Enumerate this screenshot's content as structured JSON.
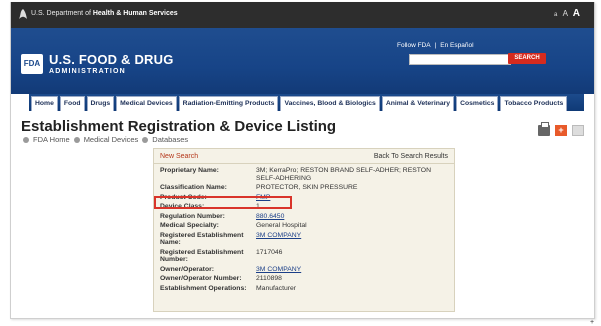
{
  "hhs": {
    "prefix": "U.S. Department of ",
    "bold": "Health & Human Services"
  },
  "font_size_controls": [
    "a",
    "A",
    "A"
  ],
  "masthead": {
    "logo": "FDA",
    "title": "U.S. FOOD & DRUG",
    "subtitle": "ADMINISTRATION",
    "follow_link": "Follow FDA",
    "sep": "|",
    "espanol_link": "En Español",
    "search_value": "",
    "search_button": "SEARCH"
  },
  "nav_tabs": [
    "Home",
    "Food",
    "Drugs",
    "Medical Devices",
    "Radiation-Emitting Products",
    "Vaccines, Blood & Biologics",
    "Animal & Veterinary",
    "Cosmetics",
    "Tobacco Products"
  ],
  "page_title": "Establishment Registration & Device Listing",
  "breadcrumb": [
    "FDA Home",
    "Medical Devices",
    "Databases"
  ],
  "panel": {
    "new_search": "New Search",
    "back_link": "Back To Search Results",
    "rows": [
      {
        "label": "Proprietary Name:",
        "value": "3M; KerraPro; RESTON BRAND SELF-ADHER; RESTON SELF-ADHERING",
        "link": false
      },
      {
        "label": "Classification Name:",
        "value": "PROTECTOR, SKIN PRESSURE",
        "link": false
      },
      {
        "label": "Product Code:",
        "value": "FMP",
        "link": true
      },
      {
        "label": "Device Class:",
        "value": "1",
        "link": false
      },
      {
        "label": "Regulation Number:",
        "value": "880.6450",
        "link": true
      },
      {
        "label": "Medical Specialty:",
        "value": "General Hospital",
        "link": false
      },
      {
        "label": "Registered Establishment Name:",
        "value": "3M COMPANY",
        "link": true
      },
      {
        "label": "Registered Establishment Number:",
        "value": "1717046",
        "link": false
      },
      {
        "label": "Owner/Operator:",
        "value": "3M COMPANY",
        "link": true
      },
      {
        "label": "Owner/Operator Number:",
        "value": "2110898",
        "link": false
      },
      {
        "label": "Establishment Operations:",
        "value": "Manufacturer",
        "link": false
      }
    ]
  },
  "icons": {
    "print": "print-icon",
    "add": "plus-icon",
    "email": "email-icon",
    "eagle": "hhs-eagle-icon"
  },
  "colors": {
    "masthead": "#174487",
    "search_button": "#d52b1e",
    "highlight": "#d9342a",
    "panel_bg": "#f5f2e7",
    "link": "#1b3f88"
  },
  "cursor": "+"
}
